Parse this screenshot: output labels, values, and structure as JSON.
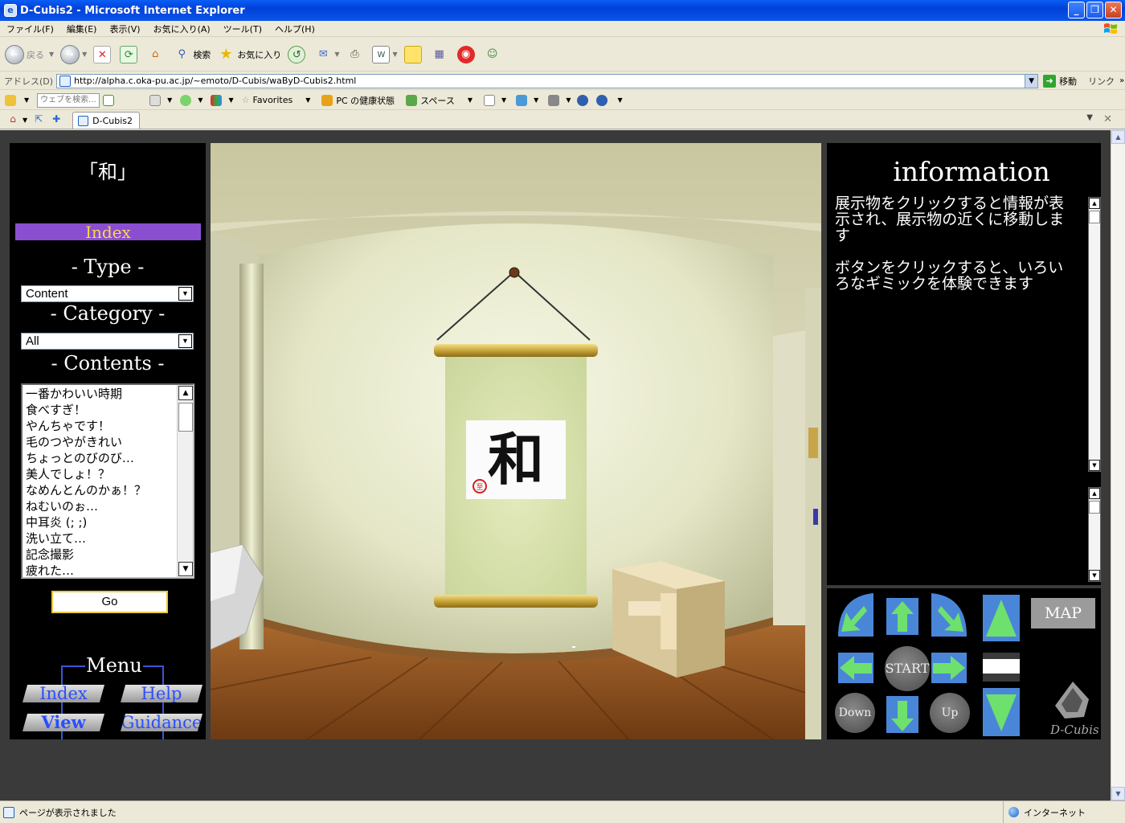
{
  "window": {
    "title": "D-Cubis2 - Microsoft Internet Explorer",
    "controls": [
      "_",
      "❐",
      "✕"
    ]
  },
  "menubar": [
    "ファイル(F)",
    "編集(E)",
    "表示(V)",
    "お気に入り(A)",
    "ツール(T)",
    "ヘルプ(H)"
  ],
  "toolbar": {
    "back": "戻る",
    "search": "検索",
    "favorites": "お気に入り"
  },
  "address": {
    "label": "アドレス(D)",
    "url": "http://alpha.c.oka-pu.ac.jp/~emoto/D-Cubis/waByD-Cubis2.html",
    "go": "移動",
    "links": "リンク"
  },
  "linksbar": {
    "search_placeholder": "ウェブを検索...",
    "favorites": "Favorites",
    "health": "PC の健康状態",
    "spaces": "スペース"
  },
  "tab": {
    "label": "D-Cubis2"
  },
  "left": {
    "title": "「和」",
    "index_label": "Index",
    "type_title": "- Type -",
    "type_value": "Content",
    "category_title": "- Category -",
    "category_value": "All",
    "contents_title": "- Contents -",
    "contents": [
      "一番かわいい時期",
      "食べすぎ！",
      "やんちゃです！",
      "毛のつやがきれい",
      "ちょっとのびのび…",
      "美人でしょ！？",
      "なめんとんのかぁ！？",
      "ねむいのぉ…",
      "中耳炎 (; ;)",
      "洗い立て…",
      "記念撮影",
      "疲れた…"
    ],
    "go_label": "Go",
    "menu_title": "Menu",
    "menu": {
      "index": "Index",
      "help": "Help",
      "view": "View",
      "guidance": "Guidance"
    }
  },
  "scene": {
    "scroll_kanji": "和",
    "seal_text": "至"
  },
  "info": {
    "title": "information",
    "text1": "展示物をクリックすると情報が表示され、展示物の近くに移動します",
    "text2": "ボタンをクリックすると、いろいろなギミックを体験できます"
  },
  "nav": {
    "start": "START",
    "down": "Down",
    "up": "Up",
    "map": "MAP",
    "logo": "D-Cubis"
  },
  "status": {
    "text": "ページが表示されました",
    "zone": "インターネット"
  },
  "colors": {
    "accent_blue": "#4a86d8",
    "arrow_green": "#6ee06e",
    "index_purple": "#8a4fd1",
    "index_text": "#ffd64a"
  }
}
